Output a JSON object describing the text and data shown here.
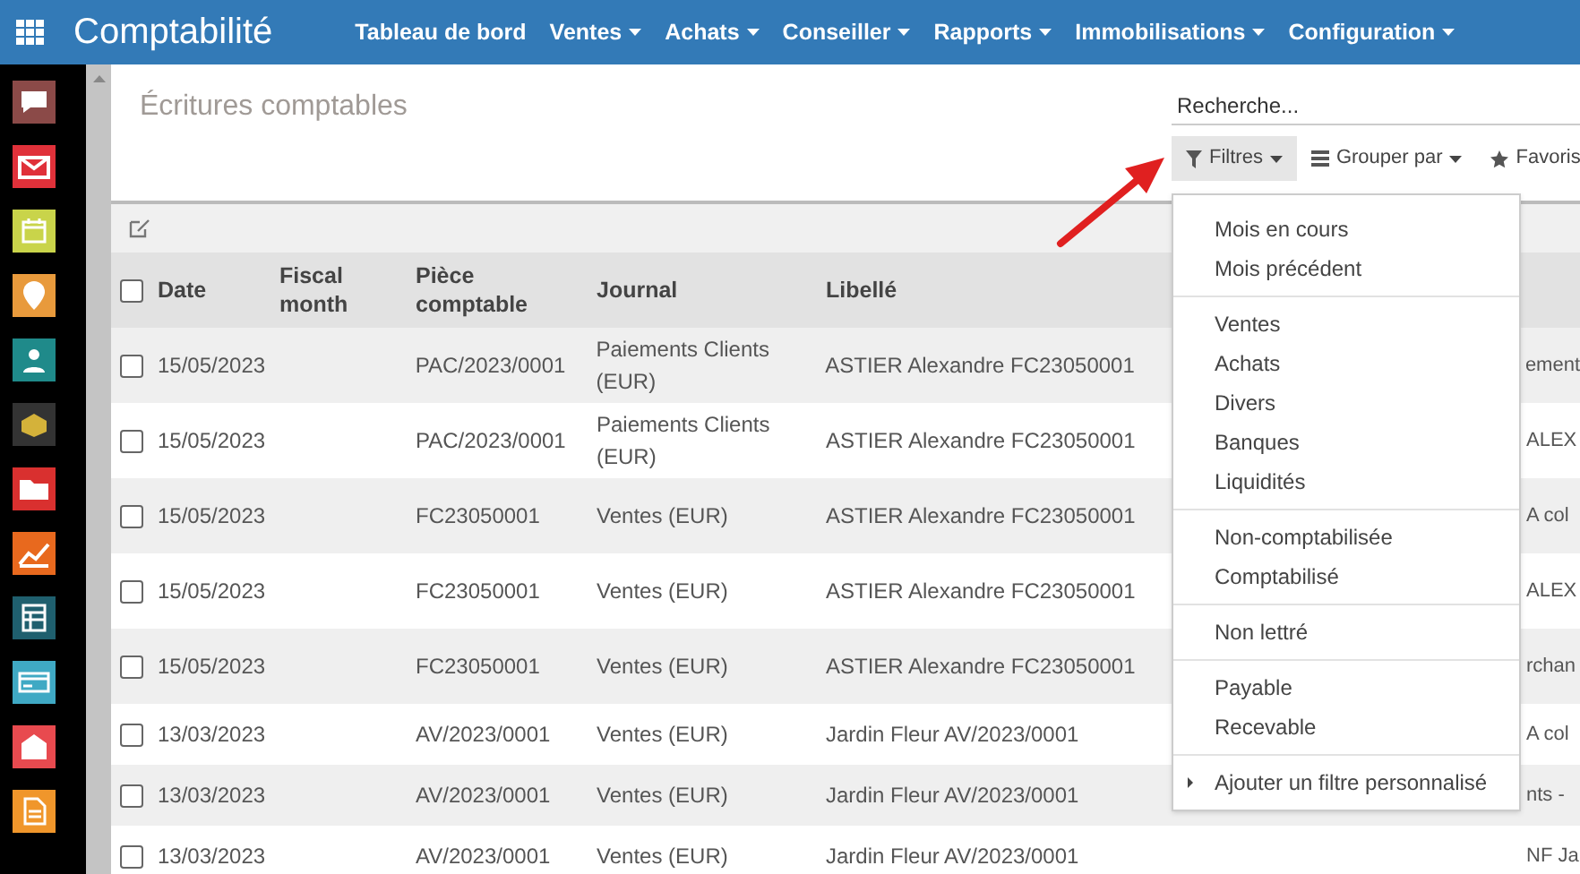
{
  "app": {
    "title": "Comptabilité"
  },
  "menu": [
    {
      "label": "Tableau de bord",
      "dropdown": false
    },
    {
      "label": "Ventes",
      "dropdown": true
    },
    {
      "label": "Achats",
      "dropdown": true
    },
    {
      "label": "Conseiller",
      "dropdown": true
    },
    {
      "label": "Rapports",
      "dropdown": true
    },
    {
      "label": "Immobilisations",
      "dropdown": true
    },
    {
      "label": "Configuration",
      "dropdown": true
    }
  ],
  "sidebar": {
    "items": [
      {
        "kind": "chat"
      },
      {
        "kind": "mail"
      },
      {
        "kind": "calendar"
      },
      {
        "kind": "pin"
      },
      {
        "kind": "contact"
      },
      {
        "kind": "box"
      },
      {
        "kind": "folder"
      },
      {
        "kind": "chart"
      },
      {
        "kind": "sheet"
      },
      {
        "kind": "card"
      },
      {
        "kind": "building"
      },
      {
        "kind": "doc"
      }
    ]
  },
  "page": {
    "title": "Écritures comptables"
  },
  "search": {
    "placeholder": "Recherche..."
  },
  "search_buttons": [
    {
      "label": "Filtres",
      "kind": "filter",
      "selected": true
    },
    {
      "label": "Grouper par",
      "kind": "list",
      "selected": false
    },
    {
      "label": "Favoris",
      "kind": "star",
      "selected": false
    }
  ],
  "table": {
    "header_checked": false,
    "columns": [
      {
        "label": "Date"
      },
      {
        "label": "Fiscal month"
      },
      {
        "label": "Pièce comptable"
      },
      {
        "label": "Journal"
      },
      {
        "label": "Libellé"
      }
    ],
    "rows": [
      {
        "checked": false,
        "date": "15/05/2023",
        "piece": "PAC/2023/0001",
        "journal": "Paiements Clients (EUR)",
        "libelle": "ASTIER Alexandre FC23050001",
        "column_7": "ement"
      },
      {
        "checked": false,
        "date": "15/05/2023",
        "piece": "PAC/2023/0001",
        "journal": "Paiements Clients (EUR)",
        "libelle": "ASTIER Alexandre FC23050001",
        "column_7": "ALEX"
      },
      {
        "checked": false,
        "date": "15/05/2023",
        "piece": "FC23050001",
        "journal": "Ventes (EUR)",
        "libelle": "ASTIER Alexandre FC23050001",
        "column_7": "A col"
      },
      {
        "checked": false,
        "date": "15/05/2023",
        "piece": "FC23050001",
        "journal": "Ventes (EUR)",
        "libelle": "ASTIER Alexandre FC23050001",
        "column_7": "ALEX"
      },
      {
        "checked": false,
        "date": "15/05/2023",
        "piece": "FC23050001",
        "journal": "Ventes (EUR)",
        "libelle": "ASTIER Alexandre FC23050001",
        "column_7": "rchan"
      },
      {
        "checked": false,
        "date": "13/03/2023",
        "piece": "AV/2023/0001",
        "journal": "Ventes (EUR)",
        "libelle": "Jardin Fleur AV/2023/0001",
        "column_7": "A col"
      },
      {
        "checked": false,
        "date": "13/03/2023",
        "piece": "AV/2023/0001",
        "journal": "Ventes (EUR)",
        "libelle": "Jardin Fleur AV/2023/0001",
        "column_7": "nts -"
      },
      {
        "checked": false,
        "date": "13/03/2023",
        "piece": "AV/2023/0001",
        "journal": "Ventes (EUR)",
        "libelle": "Jardin Fleur AV/2023/0001",
        "column_7": "NF Ja"
      }
    ]
  },
  "filter_menu": {
    "groups": [
      [
        "Mois en cours",
        "Mois précédent"
      ],
      [
        "Ventes",
        "Achats",
        "Divers",
        "Banques",
        "Liquidités"
      ],
      [
        "Non-comptabilisée",
        "Comptabilisé"
      ],
      [
        "Non lettré"
      ],
      [
        "Payable",
        "Recevable"
      ]
    ],
    "custom_filter": "Ajouter un filtre personnalisé"
  }
}
